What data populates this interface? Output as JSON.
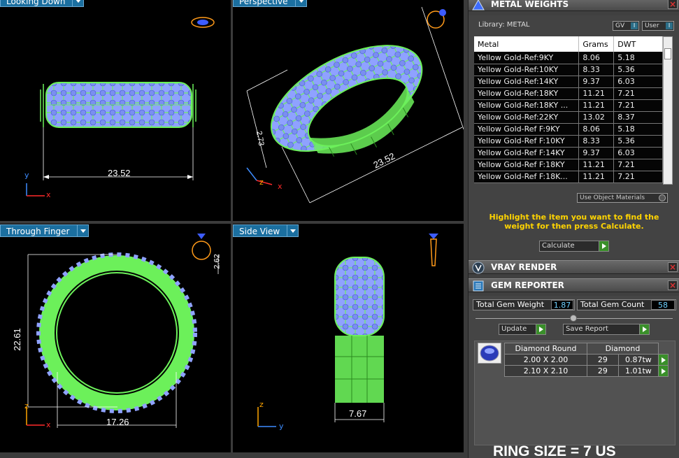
{
  "viewports": {
    "looking_down": {
      "title": "Looking Down",
      "dimension": "23.52"
    },
    "perspective": {
      "title": "Perspective",
      "width_dim": "23.52",
      "height_dim": "2.73"
    },
    "through_finger": {
      "title": "Through Finger",
      "height_dim": "22.61",
      "width_dim": "17.26",
      "top_dim": "2.62"
    },
    "side_view": {
      "title": "Side View",
      "width_dim": "7.67"
    }
  },
  "axes": {
    "x": "x",
    "y": "y",
    "z": "z"
  },
  "metal_weights": {
    "title": "METAL WEIGHTS",
    "library_label": "Library: METAL",
    "gv_label": "GV",
    "user_label": "User",
    "columns": [
      "Metal",
      "Grams",
      "DWT"
    ],
    "rows": [
      [
        "Yellow Gold-Ref:9KY",
        "8.06",
        "5.18"
      ],
      [
        "Yellow Gold-Ref:10KY",
        "8.33",
        "5.36"
      ],
      [
        "Yellow Gold-Ref:14KY",
        "9.37",
        "6.03"
      ],
      [
        "Yellow Gold-Ref:18KY",
        "11.21",
        "7.21"
      ],
      [
        "Yellow Gold-Ref:18KY ...",
        "11.21",
        "7.21"
      ],
      [
        "Yellow Gold-Ref:22KY",
        "13.02",
        "8.37"
      ],
      [
        "Yellow Gold-Ref F:9KY",
        "8.06",
        "5.18"
      ],
      [
        "Yellow Gold-Ref F:10KY",
        "8.33",
        "5.36"
      ],
      [
        "Yellow Gold-Ref F:14KY",
        "9.37",
        "6.03"
      ],
      [
        "Yellow Gold-Ref F:18KY",
        "11.21",
        "7.21"
      ],
      [
        "Yellow Gold-Ref F:18K...",
        "11.21",
        "7.21"
      ]
    ],
    "use_object_materials": "Use Object Materials",
    "instructions": "Highlight the item you want to find the weight for then press Calculate.",
    "calculate_label": "Calculate"
  },
  "vray_render": {
    "title": "VRAY RENDER"
  },
  "gem_reporter": {
    "title": "GEM REPORTER",
    "total_gem_weight_label": "Total Gem Weight",
    "total_gem_weight": "1.87",
    "total_gem_count_label": "Total Gem Count",
    "total_gem_count": "58",
    "update_label": "Update",
    "save_report_label": "Save Report",
    "gem_columns": [
      "Diamond Round",
      "Diamond"
    ],
    "gems": [
      [
        "2.00 X 2.00",
        "29",
        "0.87tw"
      ],
      [
        "2.10 X 2.10",
        "29",
        "1.01tw"
      ]
    ],
    "ring_size": "RING SIZE = 7 US"
  },
  "colors": {
    "wireframe": "#6cf05a",
    "gem_fill": "#8fa2ff",
    "dimension": "#ffffff",
    "tab": "#1b6fa0",
    "highlight_text": "#ffd400"
  }
}
